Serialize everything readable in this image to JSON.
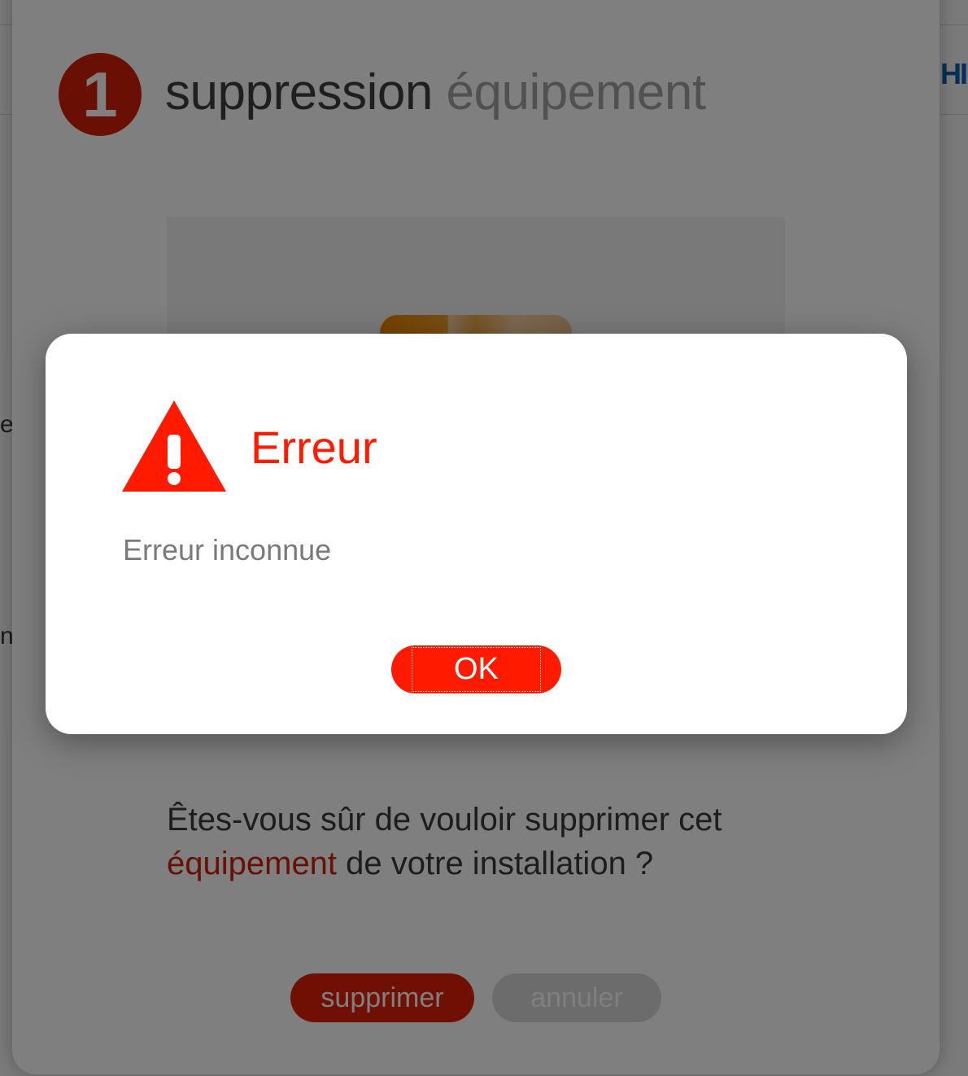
{
  "background": {
    "right_fragment": "HI",
    "left_fragments": [
      "et",
      "n"
    ]
  },
  "dialog": {
    "step_number": "1",
    "title_strong": "suppression",
    "title_light": "équipement",
    "confirm_text_before": "Êtes-vous sûr de vouloir supprimer cet ",
    "confirm_text_accent": "équipement",
    "confirm_text_after": " de votre installation ?",
    "delete_label": "supprimer",
    "cancel_label": "annuler"
  },
  "alert": {
    "title": "Erreur",
    "message": "Erreur inconnue",
    "ok_label": "OK",
    "icon": "warning-icon"
  },
  "colors": {
    "accent": "#d31f08",
    "alert_red": "#ff1a00",
    "overlay": "rgba(0,0,0,0.5)"
  }
}
